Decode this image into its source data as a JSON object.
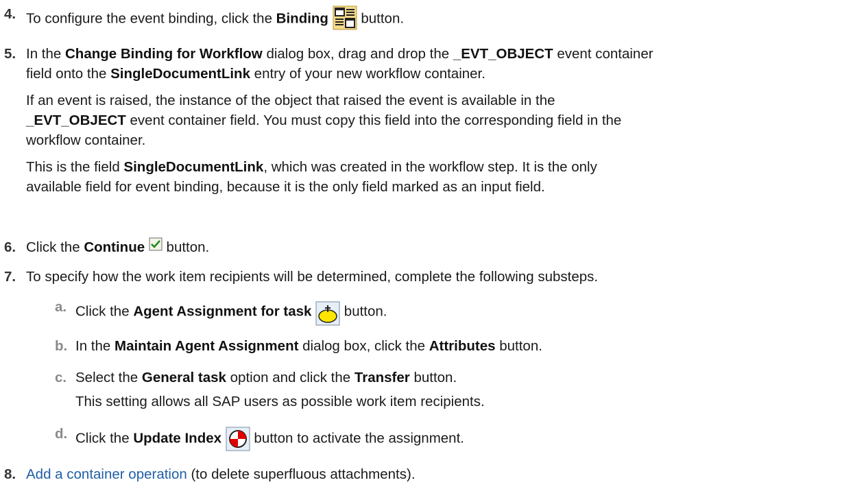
{
  "step4": {
    "num": "4.",
    "t1": "To configure the event binding, click the ",
    "b1": "Binding",
    "t2": " button.",
    "icon": "binding-icon"
  },
  "step5": {
    "num": "5.",
    "l1_t1": "In the ",
    "l1_b1": "Change Binding for Workflow",
    "l1_t2": " dialog box, drag and drop the ",
    "l1_b2": "_EVT_OBJECT",
    "l1_t3": " event container",
    "l2_t1": "field onto the ",
    "l2_b1": "SingleDocumentLink",
    "l2_t2": " entry of your new workflow container.",
    "p2_l1": "If an event is raised, the instance of the object that raised the event is available in the",
    "p2_b1": "_EVT_OBJECT",
    "p2_t2": " event container field. You must copy this field into the corresponding field in the",
    "p2_l3": "workflow container.",
    "p3_t1": "This is the field ",
    "p3_b1": "SingleDocumentLink",
    "p3_t2": ", which was created in the workflow step. It is the only",
    "p3_l2": "available field for event binding, because it is the only field marked as an input field."
  },
  "step6": {
    "num": "6.",
    "t1": "Click the ",
    "b1": "Continue",
    "t2": " button.",
    "icon": "continue-checkmark-icon"
  },
  "step7": {
    "num": "7.",
    "text": "To specify how the work item recipients will be determined, complete the following substeps.",
    "a": {
      "letter": "a.",
      "t1": "Click the ",
      "b1": "Agent Assignment for task",
      "t2": " button.",
      "icon": "agent-assignment-icon"
    },
    "b": {
      "letter": "b.",
      "t1": "In the ",
      "b1": "Maintain Agent Assignment",
      "t2": " dialog box, click the ",
      "b2": "Attributes",
      "t3": " button."
    },
    "c": {
      "letter": "c.",
      "t1": "Select the ",
      "b1": "General task",
      "t2": " option and click the ",
      "b2": "Transfer",
      "t3": " button.",
      "l2": "This setting allows all SAP users as possible work item recipients."
    },
    "d": {
      "letter": "d.",
      "t1": "Click the ",
      "b1": "Update Index",
      "t2": " button to activate the assignment.",
      "icon": "update-index-icon"
    }
  },
  "step8": {
    "num": "8.",
    "link": "Add a container operation",
    "t1": " (to delete superfluous attachments)."
  },
  "colors": {
    "link": "#1f5fa6",
    "substep_letter": "#8a8a8a"
  }
}
